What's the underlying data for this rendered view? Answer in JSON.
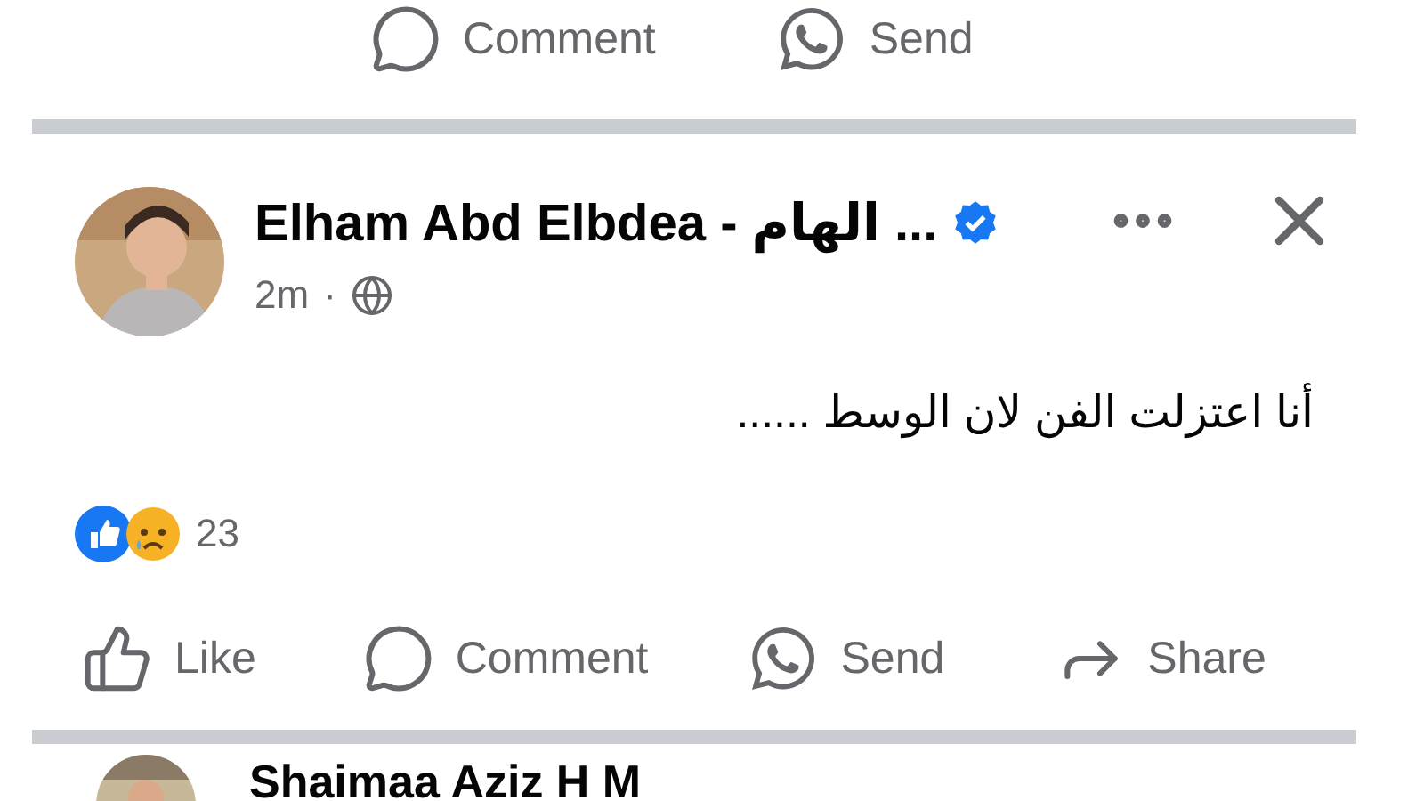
{
  "top_actions": [
    {
      "kind": "comment",
      "label": "Comment"
    },
    {
      "kind": "send",
      "label": "Send"
    }
  ],
  "post": {
    "author": "Elham Abd Elbdea - الهام ...",
    "verified": true,
    "time": "2m",
    "separator": "·",
    "text": "أنا اعتزلت الفن لان الوسط ......",
    "reaction_count": "23",
    "actions": [
      {
        "kind": "like",
        "label": "Like"
      },
      {
        "kind": "comment",
        "label": "Comment"
      },
      {
        "kind": "send",
        "label": "Send"
      },
      {
        "kind": "share",
        "label": "Share"
      }
    ]
  },
  "next_post": {
    "author": "Shaimaa Aziz H M"
  }
}
